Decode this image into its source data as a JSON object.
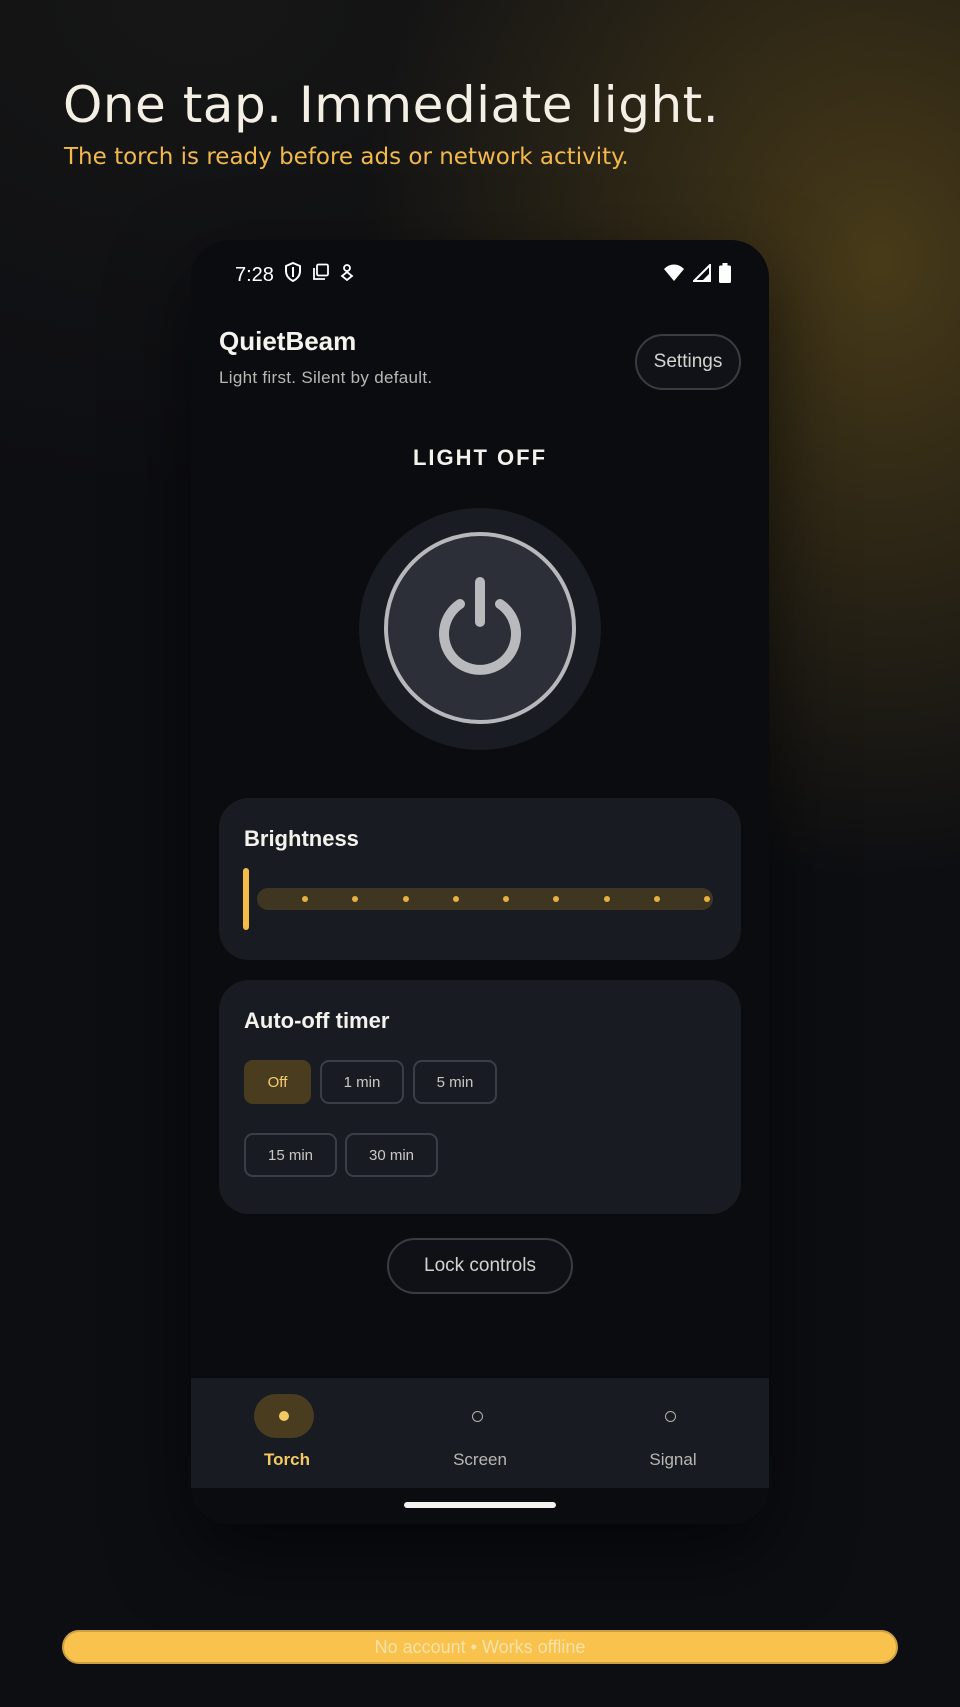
{
  "promo": {
    "headline": "One tap. Immediate light.",
    "subline": "The torch is ready before ads or network activity.",
    "footer": "No account • Works offline"
  },
  "status_bar": {
    "time": "7:28",
    "left_icons": [
      "shield-icon",
      "copy-icon",
      "location-icon"
    ],
    "right_icons": [
      "wifi-icon",
      "signal-icon",
      "battery-icon"
    ]
  },
  "app": {
    "title": "QuietBeam",
    "tagline": "Light first. Silent by default.",
    "settings_label": "Settings",
    "light_state": "LIGHT OFF"
  },
  "brightness": {
    "title": "Brightness",
    "level": 0,
    "steps": 10
  },
  "timer": {
    "title": "Auto-off timer",
    "options": [
      "Off",
      "1 min",
      "5 min",
      "15 min",
      "30 min"
    ],
    "selected": "Off"
  },
  "lock_label": "Lock controls",
  "nav": {
    "items": [
      {
        "label": "Torch",
        "active": true
      },
      {
        "label": "Screen",
        "active": false
      },
      {
        "label": "Signal",
        "active": false
      }
    ]
  },
  "colors": {
    "accent": "#f5bd45",
    "background": "#0b0c10",
    "card": "#181b22",
    "selected_chip": "#4a3d1f"
  }
}
